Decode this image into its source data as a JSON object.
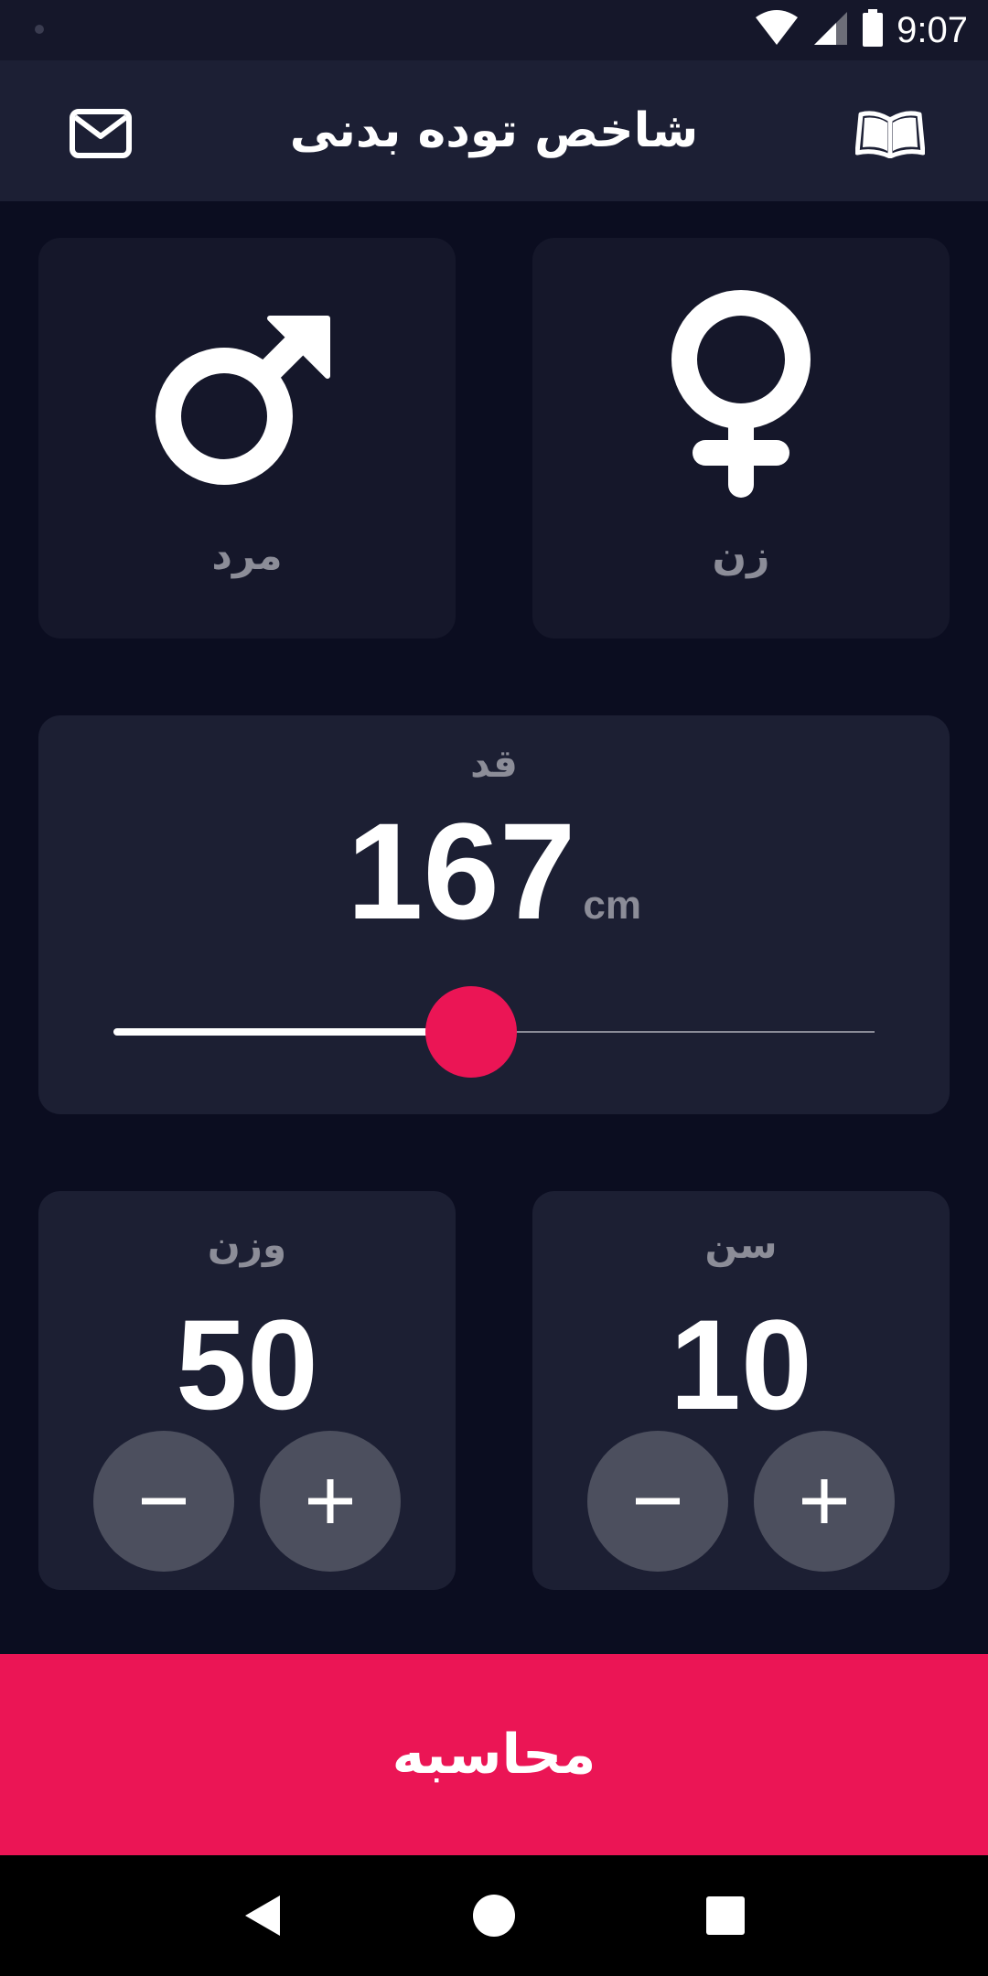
{
  "status_bar": {
    "time": "9:07",
    "icons": [
      "wifi-icon",
      "signal-icon",
      "battery-icon"
    ]
  },
  "app_bar": {
    "title": "شاخص توده بدنی",
    "left_icon": "mail-icon",
    "right_icon": "book-icon"
  },
  "gender": {
    "male_label": "مرد",
    "female_label": "زن",
    "male_icon": "male-symbol-icon",
    "female_icon": "female-symbol-icon"
  },
  "height": {
    "label": "قد",
    "value": "167",
    "unit": "cm",
    "slider_fraction": 0.47
  },
  "weight": {
    "label": "وزن",
    "value": "50"
  },
  "age": {
    "label": "سن",
    "value": "10"
  },
  "calculate": {
    "label": "محاسبه"
  },
  "colors": {
    "background": "#0b0d20",
    "card": "#1c1f33",
    "accent": "#eb1555",
    "round_button": "#4c4f5e",
    "label_gray": "#8c8d98"
  },
  "nav_bar": {
    "icons": [
      "back-icon",
      "home-icon",
      "recents-icon"
    ]
  }
}
